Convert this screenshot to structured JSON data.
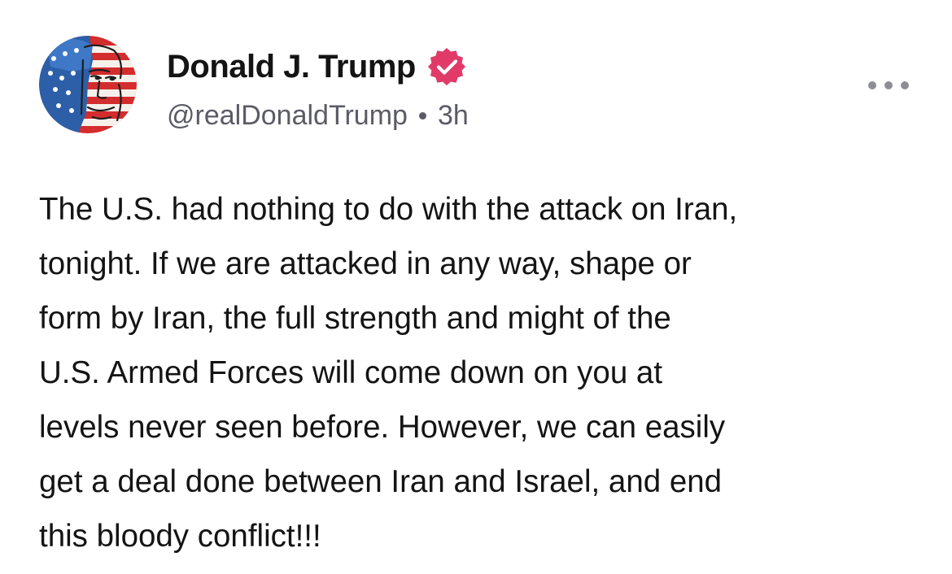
{
  "author": {
    "display_name": "Donald J. Trump",
    "handle": "@realDonaldTrump",
    "timestamp": "3h",
    "verified": true,
    "avatar_icon": "flag-portrait-avatar",
    "verified_icon": "verified-badge-icon"
  },
  "menu": {
    "icon": "more-horizontal-icon"
  },
  "post": {
    "lines": [
      "The U.S. had nothing to do with the attack on Iran,",
      "tonight. If we are attacked in any way, shape or",
      "form by Iran, the full strength and might of the",
      "U.S. Armed Forces will come down on you at",
      "levels never seen before. However, we can easily",
      "get a deal done between Iran and Israel, and end",
      "this bloody conflict!!!"
    ]
  },
  "colors": {
    "verified_badge": "#e13a69",
    "text_primary": "#141414",
    "text_secondary": "#5b5b66",
    "menu_dots": "#8d8d96"
  }
}
